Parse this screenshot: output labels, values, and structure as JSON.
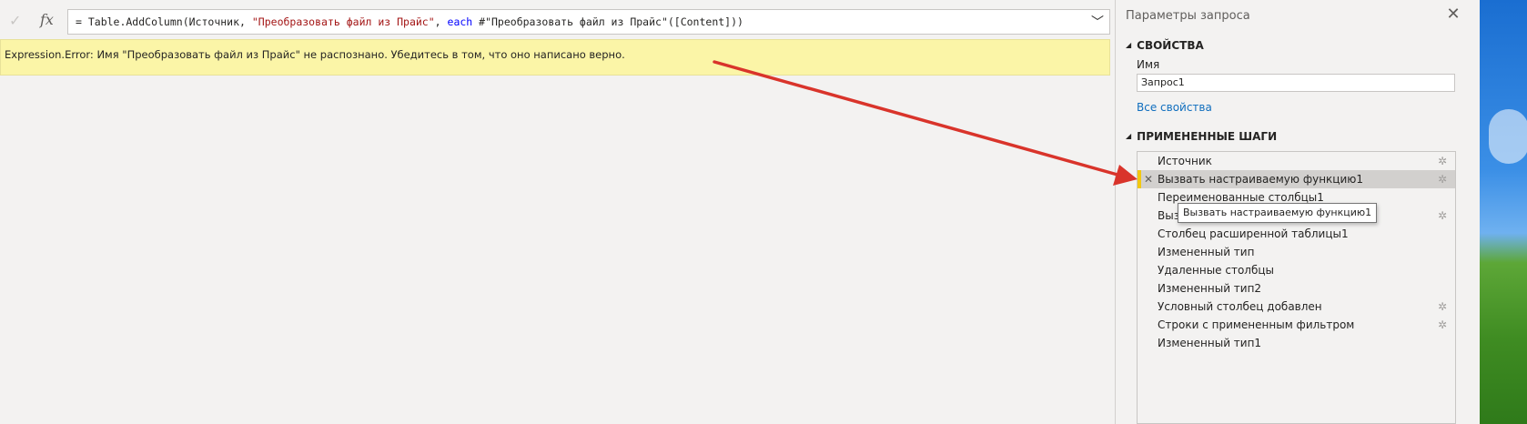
{
  "formula_bar": {
    "prefix": "= Table.AddColumn(Источник, ",
    "str1": "\"Преобразовать файл из Прайс\"",
    "comma": ", ",
    "kw": "each",
    "rest": " #\"Преобразовать файл из Прайс\"([Content]))"
  },
  "error": {
    "message": "Expression.Error: Имя \"Преобразовать файл из Прайс\" не распознано. Убедитесь в том, что оно написано верно."
  },
  "query_settings": {
    "title": "Параметры запроса",
    "properties_header": "СВОЙСТВА",
    "name_label": "Имя",
    "name_value": "Запрос1",
    "all_properties": "Все свойства",
    "applied_steps_header": "ПРИМЕНЕННЫЕ ШАГИ",
    "steps": [
      {
        "label": "Источник",
        "gear": true
      },
      {
        "label": "Вызвать настраиваемую функцию1",
        "gear": true,
        "selected": true
      },
      {
        "label": "Переименованные столбцы1",
        "gear": false
      },
      {
        "label": "Вызвать настраиваемую функцию1",
        "gear": true
      },
      {
        "label": "Столбец расширенной таблицы1",
        "gear": false
      },
      {
        "label": "Измененный тип",
        "gear": false
      },
      {
        "label": "Удаленные столбцы",
        "gear": false
      },
      {
        "label": "Измененный тип2",
        "gear": false
      },
      {
        "label": "Условный столбец добавлен",
        "gear": true
      },
      {
        "label": "Строки с примененным фильтром",
        "gear": true
      },
      {
        "label": "Измененный тип1",
        "gear": false
      }
    ],
    "tooltip": "Вызвать настраиваемую функцию1"
  },
  "icons": {
    "check": "✓",
    "fx": "fx",
    "chevron": "﹀",
    "close": "✕",
    "gear": "✲",
    "delete_step": "✕",
    "collapse": "◢"
  },
  "colors": {
    "error_bg": "#fbf5a7",
    "arrow": "#d9342b",
    "link": "#106ebe",
    "selected_marker": "#f2c811"
  }
}
